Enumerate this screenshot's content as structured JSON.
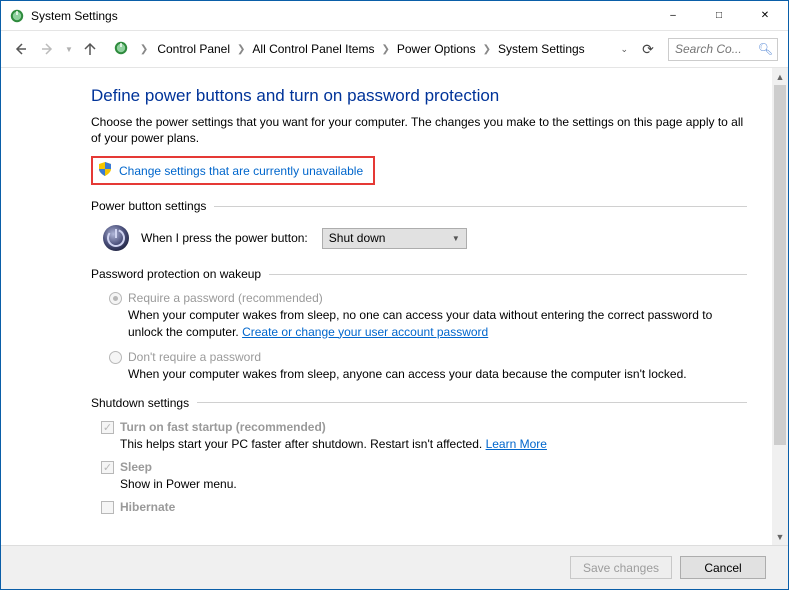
{
  "window": {
    "title": "System Settings"
  },
  "breadcrumb": {
    "items": [
      "Control Panel",
      "All Control Panel Items",
      "Power Options",
      "System Settings"
    ]
  },
  "search": {
    "placeholder": "Search Co..."
  },
  "main": {
    "heading": "Define power buttons and turn on password protection",
    "intro": "Choose the power settings that you want for your computer. The changes you make to the settings on this page apply to all of your power plans.",
    "change_link": "Change settings that are currently unavailable"
  },
  "power_button": {
    "section_title": "Power button settings",
    "label": "When I press the power button:",
    "value": "Shut down"
  },
  "password": {
    "section_title": "Password protection on wakeup",
    "require": {
      "label": "Require a password (recommended)",
      "desc_pre": "When your computer wakes from sleep, no one can access your data without entering the correct password to unlock the computer. ",
      "link": "Create or change your user account password"
    },
    "norequire": {
      "label": "Don't require a password",
      "desc": "When your computer wakes from sleep, anyone can access your data because the computer isn't locked."
    }
  },
  "shutdown": {
    "section_title": "Shutdown settings",
    "fast": {
      "label": "Turn on fast startup (recommended)",
      "desc_pre": "This helps start your PC faster after shutdown. Restart isn't affected. ",
      "link": "Learn More"
    },
    "sleep": {
      "label": "Sleep",
      "desc": "Show in Power menu."
    },
    "hibernate": {
      "label": "Hibernate"
    }
  },
  "footer": {
    "save": "Save changes",
    "cancel": "Cancel"
  }
}
